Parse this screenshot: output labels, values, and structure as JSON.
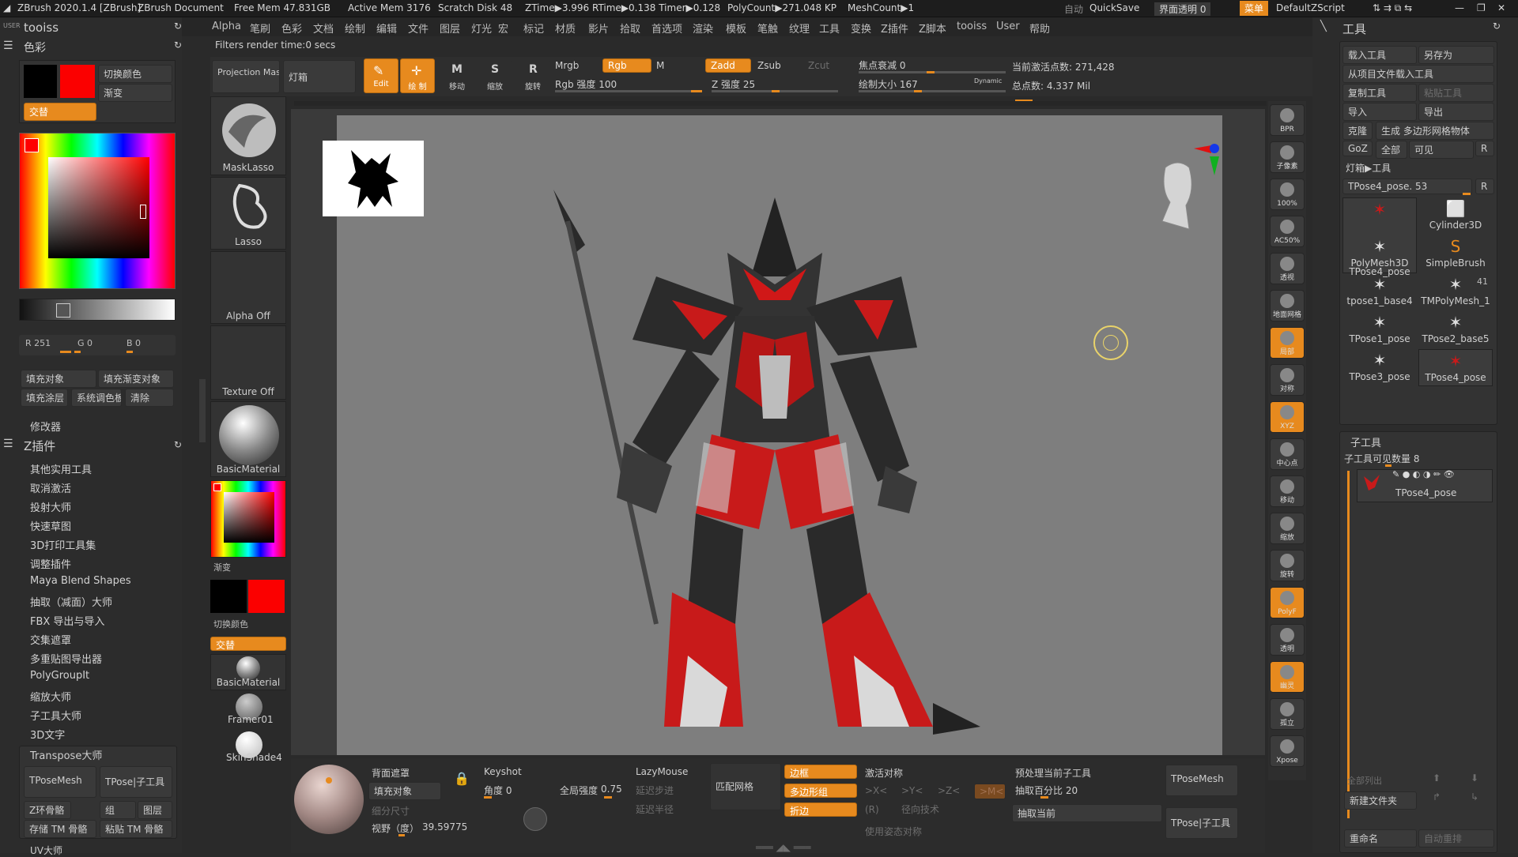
{
  "titlebar": {
    "app": "ZBrush 2020.1.4 [ZBrush]",
    "doc": "ZBrush Document",
    "free_mem": "Free Mem 47.831GB",
    "active_mem": "Active Mem 3176",
    "scratch": "Scratch Disk 48",
    "ztime": "ZTime▶3.996 RTime▶0.138 Timer▶0.128",
    "polycount": "PolyCount▶271.048 KP",
    "meshcount": "MeshCount▶1",
    "auto": "自动",
    "quicksave": "QuickSave",
    "transparency": "界面透明 0",
    "menu": "菜单",
    "script": "DefaultZScript"
  },
  "menu": [
    "Alpha",
    "笔刷",
    "色彩",
    "文档",
    "绘制",
    "编辑",
    "文件",
    "图层",
    "灯光",
    "宏",
    "标记",
    "材质",
    "影片",
    "拾取",
    "首选项",
    "渲染",
    "模板",
    "笔触",
    "纹理",
    "工具",
    "变换",
    "Z插件",
    "Z脚本",
    "tooiss",
    "User",
    "帮助"
  ],
  "status": "Filters render time:0 secs",
  "left": {
    "user": "USER",
    "tooiss": "tooiss",
    "color_title": "色彩",
    "switch_color": "切换颜色",
    "gradient": "渐变",
    "alternate": "交替",
    "r": "R 251",
    "g": "G 0",
    "b": "B 0",
    "fill_obj": "填充对象",
    "fill_grad": "填充渐变对象",
    "fill_layer": "填充涂层",
    "sys_palette": "系统调色板",
    "clear": "清除",
    "modifier": "修改器",
    "zplugin": "Z插件",
    "plugins": [
      "其他实用工具",
      "取消激活",
      "投射大师",
      "快速草图",
      "3D打印工具集",
      "调整插件",
      "Maya Blend Shapes",
      "抽取（减面）大师",
      "FBX 导出与导入",
      "交集遮罩",
      "多重贴图导出器",
      "PolyGroupIt",
      "缩放大师",
      "子工具大师",
      "3D文字"
    ],
    "transpose": "Transpose大师",
    "tposemesh": "TPoseMesh",
    "tpose_sub": "TPose|子工具",
    "z_skel": "Z环骨骼",
    "group": "组",
    "layer": "图层",
    "save_tm": "存储 TM 骨骼",
    "paste_tm": "粘贴 TM 骨骼",
    "uv": "UV大师"
  },
  "brushcol": {
    "mask": "MaskLasso",
    "lasso": "Lasso",
    "alpha": "Alpha Off",
    "texture": "Texture Off",
    "material": "BasicMaterial",
    "gradient": "渐变",
    "switch": "切换颜色",
    "alternate": "交替",
    "material2": "BasicMaterial",
    "framer": "Framer01",
    "skin": "SkinShade4"
  },
  "top": {
    "projection": "Projection Master",
    "lightbox": "灯箱",
    "edit": "Edit",
    "draw": "绘 制",
    "move": "移动",
    "scale": "缩放",
    "rotate": "旋转",
    "mrgb": "Mrgb",
    "rgb": "Rgb",
    "m": "M",
    "rgb_int": "Rgb 强度 100",
    "zadd": "Zadd",
    "zsub": "Zsub",
    "zcut": "Zcut",
    "z_int": "Z 强度 25",
    "focal": "焦点衰减 0",
    "drawsize": "绘制大小 167",
    "dynamic": "Dynamic",
    "active_pts": "当前激活点数: 271,428",
    "total_pts": "总点数: 4.337 Mil"
  },
  "rightbar": [
    "BPR",
    "子像素",
    "100%",
    "AC50%",
    "透视",
    "地面网格",
    "局部",
    "对称",
    "XYZ",
    "中心点",
    "移动",
    "缩放",
    "旋转",
    "PolyF",
    "透明",
    "幽灵",
    "孤立",
    "Xpose"
  ],
  "tool": {
    "title": "工具",
    "load": "载入工具",
    "saveas": "另存为",
    "from_project": "从项目文件载入工具",
    "copy": "复制工具",
    "paste": "粘贴工具",
    "import": "导入",
    "export": "导出",
    "clone": "克隆",
    "make_poly": "生成 多边形网格物体",
    "goz": "GoZ",
    "all": "全部",
    "visible": "可见",
    "r": "R",
    "lightbox_tool": "灯箱▶工具",
    "current": "TPose4_pose. 53",
    "tools": [
      "TPose4_pose",
      "Cylinder3D",
      "PolyMesh3D",
      "SimpleBrush",
      "tpose1_base4",
      "TMPolyMesh_1",
      "TPose1_pose",
      "TPose2_base5",
      "TPose3_pose",
      "TPose4_pose"
    ],
    "count41": "41",
    "subtool": "子工具",
    "subtool_visible": "子工具可见数量 8",
    "sub_item": "TPose4_pose",
    "list_all": "全部列出",
    "new_folder": "新建文件夹",
    "rename": "重命名",
    "auto_reorder": "自动重排"
  },
  "bottom": {
    "backface": "背面遮罩",
    "fill_obj": "填充对象",
    "detail": "细分尺寸",
    "fov": "视野（度）",
    "fov_val": "39.59775",
    "keyshot": "Keyshot",
    "angle": "角度 0",
    "global": "全局强度",
    "global_val": "0.75",
    "lazymouse": "LazyMouse",
    "lazystep": "延迟步进",
    "lazyrad": "延迟半径",
    "match": "匹配网格",
    "border": "边框",
    "polygroup": "多边形组",
    "crease": "折边",
    "activate_sym": "激活对称",
    "x": ">X<",
    "y": ">Y<",
    "z": ">Z<",
    "m": ">M<",
    "r": "(R)",
    "radial": "径向技术",
    "use_pose": "使用姿态对称",
    "preprocess": "预处理当前子工具",
    "decimate_pct": "抽取百分比 20",
    "decimate_cur": "抽取当前",
    "tposemesh": "TPoseMesh",
    "tpose_sub": "TPose|子工具"
  }
}
